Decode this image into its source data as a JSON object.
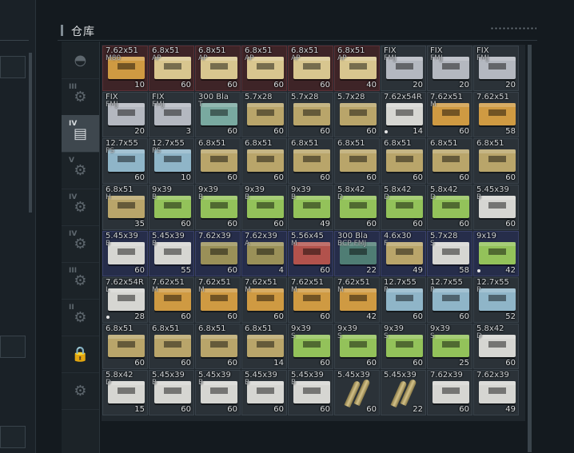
{
  "header": {
    "title": "仓库"
  },
  "tabs": [
    {
      "num": "",
      "icon": "helmet-icon",
      "glyph": "◓"
    },
    {
      "num": "III",
      "icon": "gun-icon",
      "glyph": "⚙"
    },
    {
      "num": "IV",
      "icon": "folder-icon",
      "glyph": "▤",
      "active": true
    },
    {
      "num": "V",
      "icon": "gun-icon",
      "glyph": "⚙"
    },
    {
      "num": "IV",
      "icon": "gun-icon",
      "glyph": "⚙"
    },
    {
      "num": "IV",
      "icon": "gun-icon",
      "glyph": "⚙"
    },
    {
      "num": "III",
      "icon": "gun-icon",
      "glyph": "⚙"
    },
    {
      "num": "II",
      "icon": "gun-icon",
      "glyph": "⚙"
    },
    {
      "num": "",
      "icon": "lock-icon",
      "glyph": "🔒"
    },
    {
      "num": "",
      "icon": "gear-icon",
      "glyph": "⚙"
    }
  ],
  "colors": {
    "tan": "#b9a56a",
    "sand": "#d8c68f",
    "orange": "#cf9a42",
    "grey": "#b4b8c0",
    "white": "#d6d6d2",
    "teal": "#79a9a0",
    "blue": "#8fb5c8",
    "green": "#93c25a",
    "red": "#b2524c",
    "olive": "#9a9058",
    "dteal": "#4f7d74"
  },
  "cells": [
    [
      "7.62x51",
      "M80",
      "10",
      "orange",
      "red"
    ],
    [
      "6.8x51",
      "AP",
      "60",
      "sand",
      "red"
    ],
    [
      "6.8x51",
      "AP",
      "60",
      "sand",
      "red"
    ],
    [
      "6.8x51",
      "AP",
      "60",
      "sand",
      "red"
    ],
    [
      "6.8x51",
      "AP",
      "60",
      "sand",
      "red"
    ],
    [
      "6.8x51",
      "AP",
      "40",
      "sand",
      "red"
    ],
    [
      "FIX",
      "FMJ",
      "20",
      "grey",
      ""
    ],
    [
      "FIX",
      "FMJ",
      "20",
      "grey",
      ""
    ],
    [
      "FIX",
      "FMJ",
      "20",
      "grey",
      ""
    ],
    [
      "FIX",
      "FMJ",
      "20",
      "grey",
      ""
    ],
    [
      "FIX",
      "FMJ",
      "3",
      "grey",
      ""
    ],
    [
      "300 Bla",
      "T",
      "60",
      "teal",
      ""
    ],
    [
      "5.7x28",
      "",
      "60",
      "tan",
      ""
    ],
    [
      "5.7x28",
      "",
      "60",
      "tan",
      ""
    ],
    [
      "5.7x28",
      "",
      "60",
      "tan",
      ""
    ],
    [
      "7.62x54R",
      "",
      "14",
      "white",
      "",
      true
    ],
    [
      "7.62x51",
      "M",
      "60",
      "orange",
      ""
    ],
    [
      "7.62x51",
      "",
      "58",
      "orange",
      ""
    ],
    [
      "12.7x55",
      "PS",
      "60",
      "blue",
      ""
    ],
    [
      "12.7x55",
      "PS",
      "10",
      "blue",
      ""
    ],
    [
      "6.8x51",
      "",
      "60",
      "tan",
      ""
    ],
    [
      "6.8x51",
      "",
      "60",
      "tan",
      ""
    ],
    [
      "6.8x51",
      "",
      "60",
      "tan",
      ""
    ],
    [
      "6.8x51",
      "",
      "60",
      "tan",
      ""
    ],
    [
      "6.8x51",
      "",
      "60",
      "tan",
      ""
    ],
    [
      "6.8x51",
      "",
      "60",
      "tan",
      ""
    ],
    [
      "6.8x51",
      "",
      "60",
      "tan",
      ""
    ],
    [
      "6.8x51",
      "H",
      "35",
      "tan",
      ""
    ],
    [
      "9x39",
      "B",
      "60",
      "green",
      ""
    ],
    [
      "9x39",
      "B",
      "60",
      "green",
      ""
    ],
    [
      "9x39",
      "B",
      "60",
      "green",
      ""
    ],
    [
      "9x39",
      "B",
      "49",
      "green",
      ""
    ],
    [
      "5.8x42",
      "D",
      "60",
      "green",
      ""
    ],
    [
      "5.8x42",
      "D",
      "60",
      "green",
      ""
    ],
    [
      "5.8x42",
      "D",
      "60",
      "green",
      ""
    ],
    [
      "5.45x39",
      "B",
      "60",
      "white",
      ""
    ],
    [
      "5.45x39",
      "B",
      "60",
      "white",
      "bbg"
    ],
    [
      "5.45x39",
      "B",
      "55",
      "white",
      "bbg"
    ],
    [
      "7.62x39",
      "",
      "60",
      "olive",
      "bbg"
    ],
    [
      "7.62x39",
      "A",
      "4",
      "olive",
      "bbg"
    ],
    [
      "5.56x45",
      "M",
      "60",
      "red",
      "bbg"
    ],
    [
      "300 Bla",
      "BCP FMJ",
      "22",
      "dteal",
      "bbg"
    ],
    [
      "4.6x30",
      "F",
      "49",
      "tan",
      "bbg"
    ],
    [
      "5.7x28",
      "S",
      "58",
      "white",
      "bbg"
    ],
    [
      "9x19",
      "",
      "42",
      "green",
      "bbg",
      true
    ],
    [
      "7.62x54R",
      "L",
      "28",
      "white",
      "",
      true
    ],
    [
      "7.62x51",
      "M",
      "60",
      "orange",
      ""
    ],
    [
      "7.62x51",
      "M",
      "60",
      "orange",
      ""
    ],
    [
      "7.62x51",
      "M",
      "60",
      "orange",
      ""
    ],
    [
      "7.62x51",
      "M",
      "60",
      "orange",
      ""
    ],
    [
      "7.62x51",
      "M",
      "42",
      "orange",
      ""
    ],
    [
      "12.7x55",
      "P",
      "60",
      "blue",
      ""
    ],
    [
      "12.7x55",
      "P",
      "60",
      "blue",
      ""
    ],
    [
      "12.7x55",
      "P",
      "52",
      "blue",
      ""
    ],
    [
      "6.8x51",
      "",
      "60",
      "tan",
      ""
    ],
    [
      "6.8x51",
      "",
      "60",
      "tan",
      ""
    ],
    [
      "6.8x51",
      "",
      "60",
      "tan",
      ""
    ],
    [
      "6.8x51",
      "",
      "14",
      "tan",
      ""
    ],
    [
      "9x39",
      "S",
      "60",
      "green",
      ""
    ],
    [
      "9x39",
      "S",
      "60",
      "green",
      ""
    ],
    [
      "9x39",
      "S",
      "60",
      "green",
      ""
    ],
    [
      "9x39",
      "S",
      "25",
      "green",
      ""
    ],
    [
      "5.8x42",
      "D",
      "60",
      "white",
      ""
    ],
    [
      "5.8x42",
      "D",
      "15",
      "white",
      ""
    ],
    [
      "5.45x39",
      "B",
      "60",
      "white",
      ""
    ],
    [
      "5.45x39",
      "B",
      "60",
      "white",
      ""
    ],
    [
      "5.45x39",
      "B",
      "60",
      "white",
      ""
    ],
    [
      "5.45x39",
      "B",
      "60",
      "white",
      ""
    ],
    [
      "5.45x39",
      "",
      "60",
      "bullet",
      ""
    ],
    [
      "5.45x39",
      "",
      "22",
      "bullet",
      ""
    ],
    [
      "7.62x39",
      "",
      "60",
      "white",
      ""
    ],
    [
      "7.62x39",
      "",
      "49",
      "white",
      ""
    ]
  ]
}
